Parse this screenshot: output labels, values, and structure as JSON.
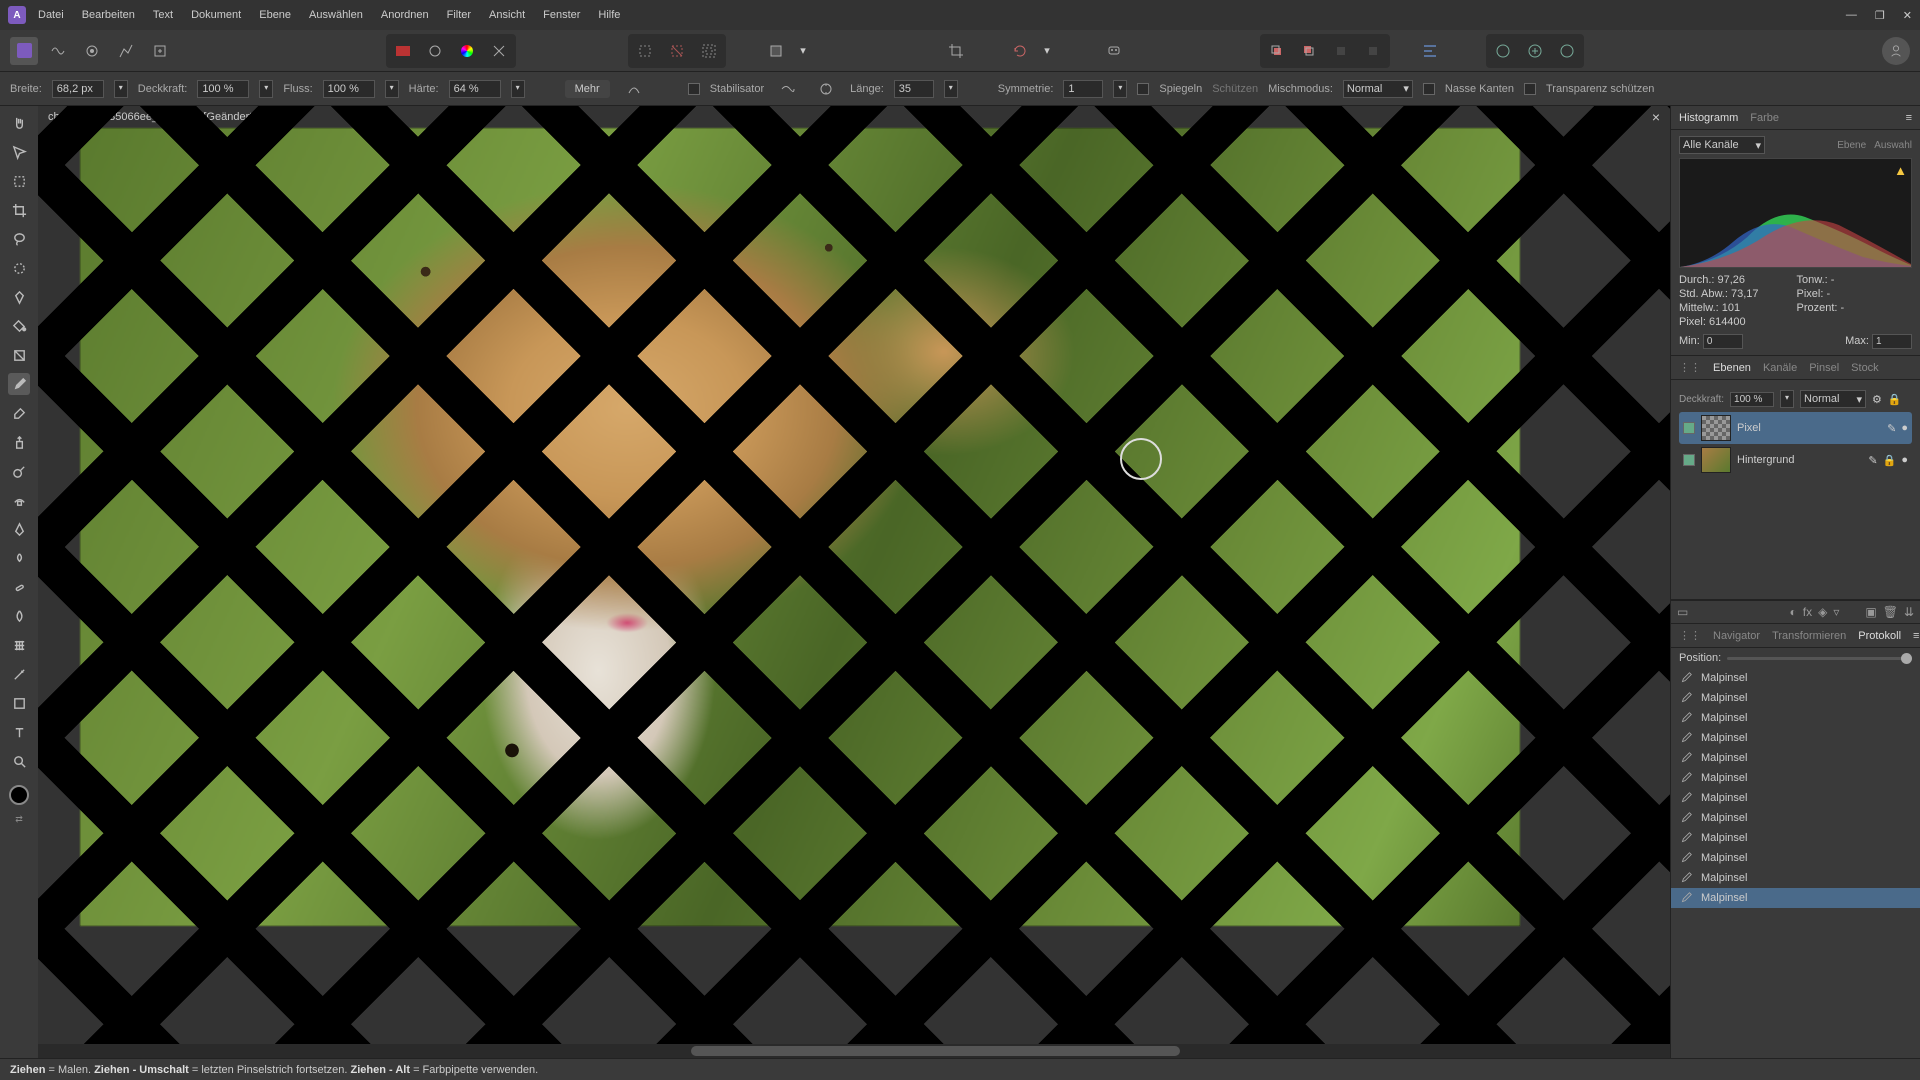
{
  "menu": {
    "items": [
      "Datei",
      "Bearbeiten",
      "Text",
      "Dokument",
      "Ebene",
      "Auswählen",
      "Anordnen",
      "Filter",
      "Ansicht",
      "Fenster",
      "Hilfe"
    ]
  },
  "win": {
    "min": "—",
    "max": "❐",
    "close": "✕"
  },
  "doc": {
    "tab_title": "cheetah-g3635066ee_1920.jpg [Geändert] (75,0%)",
    "close": "×"
  },
  "options": {
    "width_label": "Breite:",
    "width": "68,2 px",
    "opacity_label": "Deckkraft:",
    "opacity": "100 %",
    "flow_label": "Fluss:",
    "flow": "100 %",
    "hardness_label": "Härte:",
    "hardness": "64 %",
    "more": "Mehr",
    "stabilizer": "Stabilisator",
    "length_label": "Länge:",
    "length": "35",
    "symmetry_label": "Symmetrie:",
    "symmetry": "1",
    "mirror": "Spiegeln",
    "protect": "Schützen",
    "blend_label": "Mischmodus:",
    "blend": "Normal",
    "wet": "Nasse Kanten",
    "alpha": "Transparenz schützen"
  },
  "hist_panel": {
    "tabs": [
      "Histogramm",
      "Farbe"
    ],
    "channel": "Alle Kanäle",
    "lbl_layer": "Ebene",
    "lbl_sel": "Auswahl",
    "stats": {
      "durch": "Durch.: 97,26",
      "ton": "Tonw.: -",
      "std": "Std. Abw.: 73,17",
      "px": "Pixel: -",
      "median": "Mittelw.: 101",
      "pct": "Prozent: -",
      "pixel": "Pixel: 614400"
    },
    "min_label": "Min:",
    "min": "0",
    "max_label": "Max:",
    "max": "1"
  },
  "layers_panel": {
    "tabs": [
      "Ebenen",
      "Kanäle",
      "Pinsel",
      "Stock"
    ],
    "opacity_label": "Deckkraft:",
    "opacity": "100 %",
    "blend": "Normal",
    "layers": [
      {
        "name": "Pixel",
        "selected": true
      },
      {
        "name": "Hintergrund",
        "selected": false
      }
    ]
  },
  "nav_panel": {
    "tabs": [
      "Navigator",
      "Transformieren",
      "Protokoll"
    ],
    "pos_label": "Position:"
  },
  "history": {
    "entry": "Malpinsel",
    "count": 12
  },
  "status": {
    "s1a": "Ziehen",
    "s1b": " = Malen. ",
    "s2a": "Ziehen - Umschalt",
    "s2b": " = letzten Pinselstrich fortsetzen. ",
    "s3a": "Ziehen - Alt",
    "s3b": " = Farbpipette verwenden."
  }
}
